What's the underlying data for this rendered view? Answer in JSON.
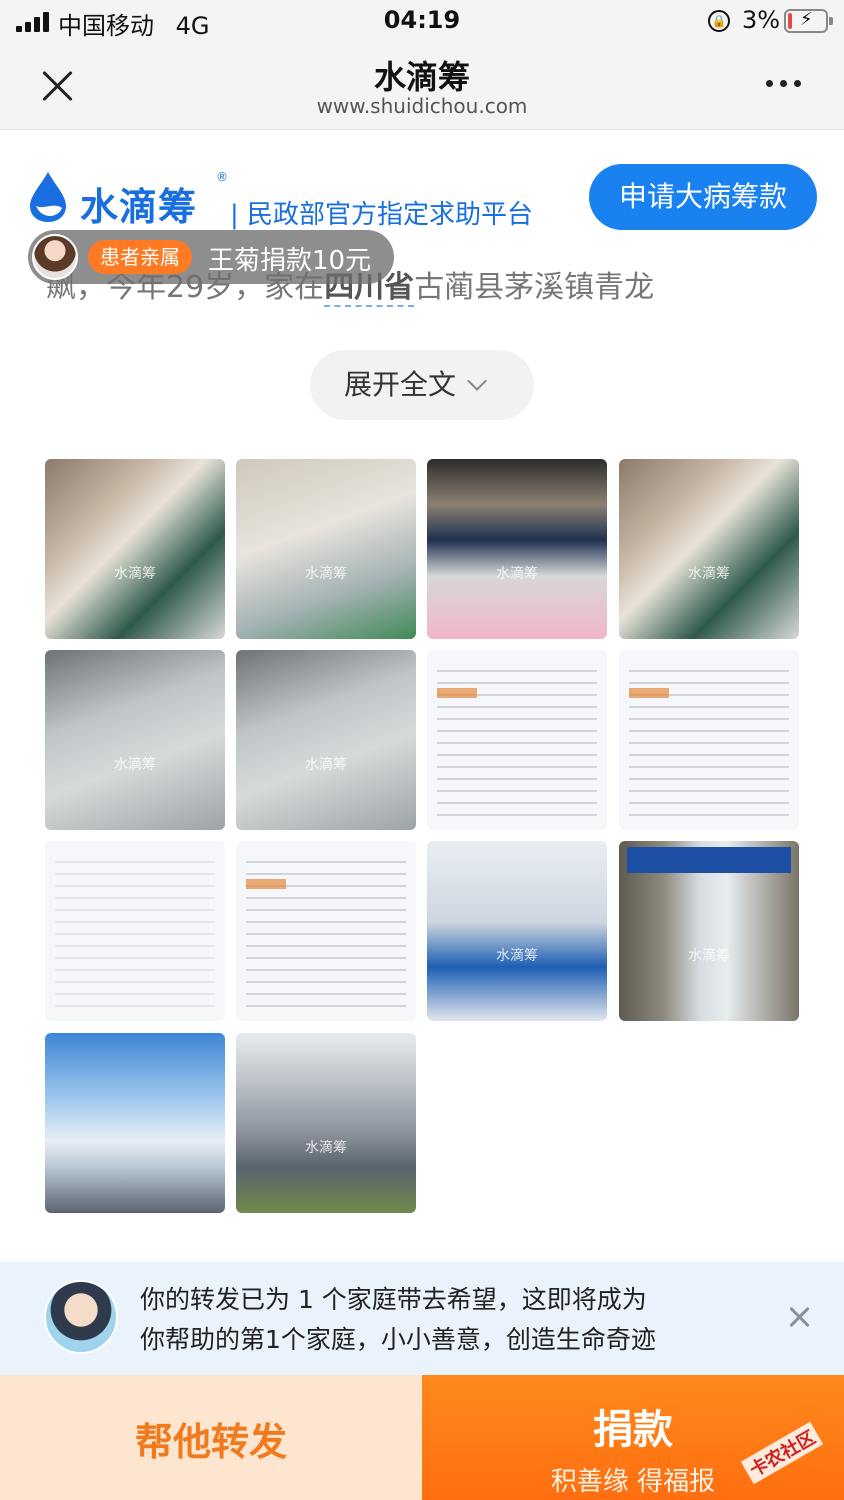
{
  "status_bar": {
    "carrier": "中国移动",
    "network": "4G",
    "time": "04:19",
    "battery_pct": "3%"
  },
  "nav": {
    "title": "水滴筹",
    "url": "www.shuidichou.com",
    "close_icon": "close-icon",
    "more_icon": "more-dots-icon"
  },
  "brand": {
    "name": "水滴筹",
    "registered": "®",
    "slogan": "| 民政部官方指定求助平台",
    "apply_button": "申请大病筹款",
    "accent": "#1a82f0"
  },
  "story": {
    "prefix": "飙，今年29岁，家在",
    "highlight": "四川省",
    "suffix": "古蔺县茅溪镇青龙"
  },
  "donor_toast": {
    "badge": "患者亲属",
    "text": "王菊捐款10元"
  },
  "expand": {
    "label": "展开全文"
  },
  "gallery": {
    "watermark": "水滴筹",
    "items": [
      {
        "kind": "patient"
      },
      {
        "kind": "ward"
      },
      {
        "kind": "bed"
      },
      {
        "kind": "patient"
      },
      {
        "kind": "sheet"
      },
      {
        "kind": "sheet"
      },
      {
        "kind": "doc"
      },
      {
        "kind": "doc"
      },
      {
        "kind": "doc"
      },
      {
        "kind": "doc"
      },
      {
        "kind": "hosp"
      },
      {
        "kind": "eicu"
      },
      {
        "kind": "sky"
      },
      {
        "kind": "bldg"
      }
    ]
  },
  "share_banner": {
    "line1": "你的转发已为 1 个家庭带去希望，这即将成为",
    "line2": "你帮助的第1个家庭，小小善意，创造生命奇迹"
  },
  "bottom_bar": {
    "share_label": "帮他转发",
    "donate_label": "捐款",
    "donate_sub": "积善缘 得福报",
    "watermark": "卡农社区"
  }
}
